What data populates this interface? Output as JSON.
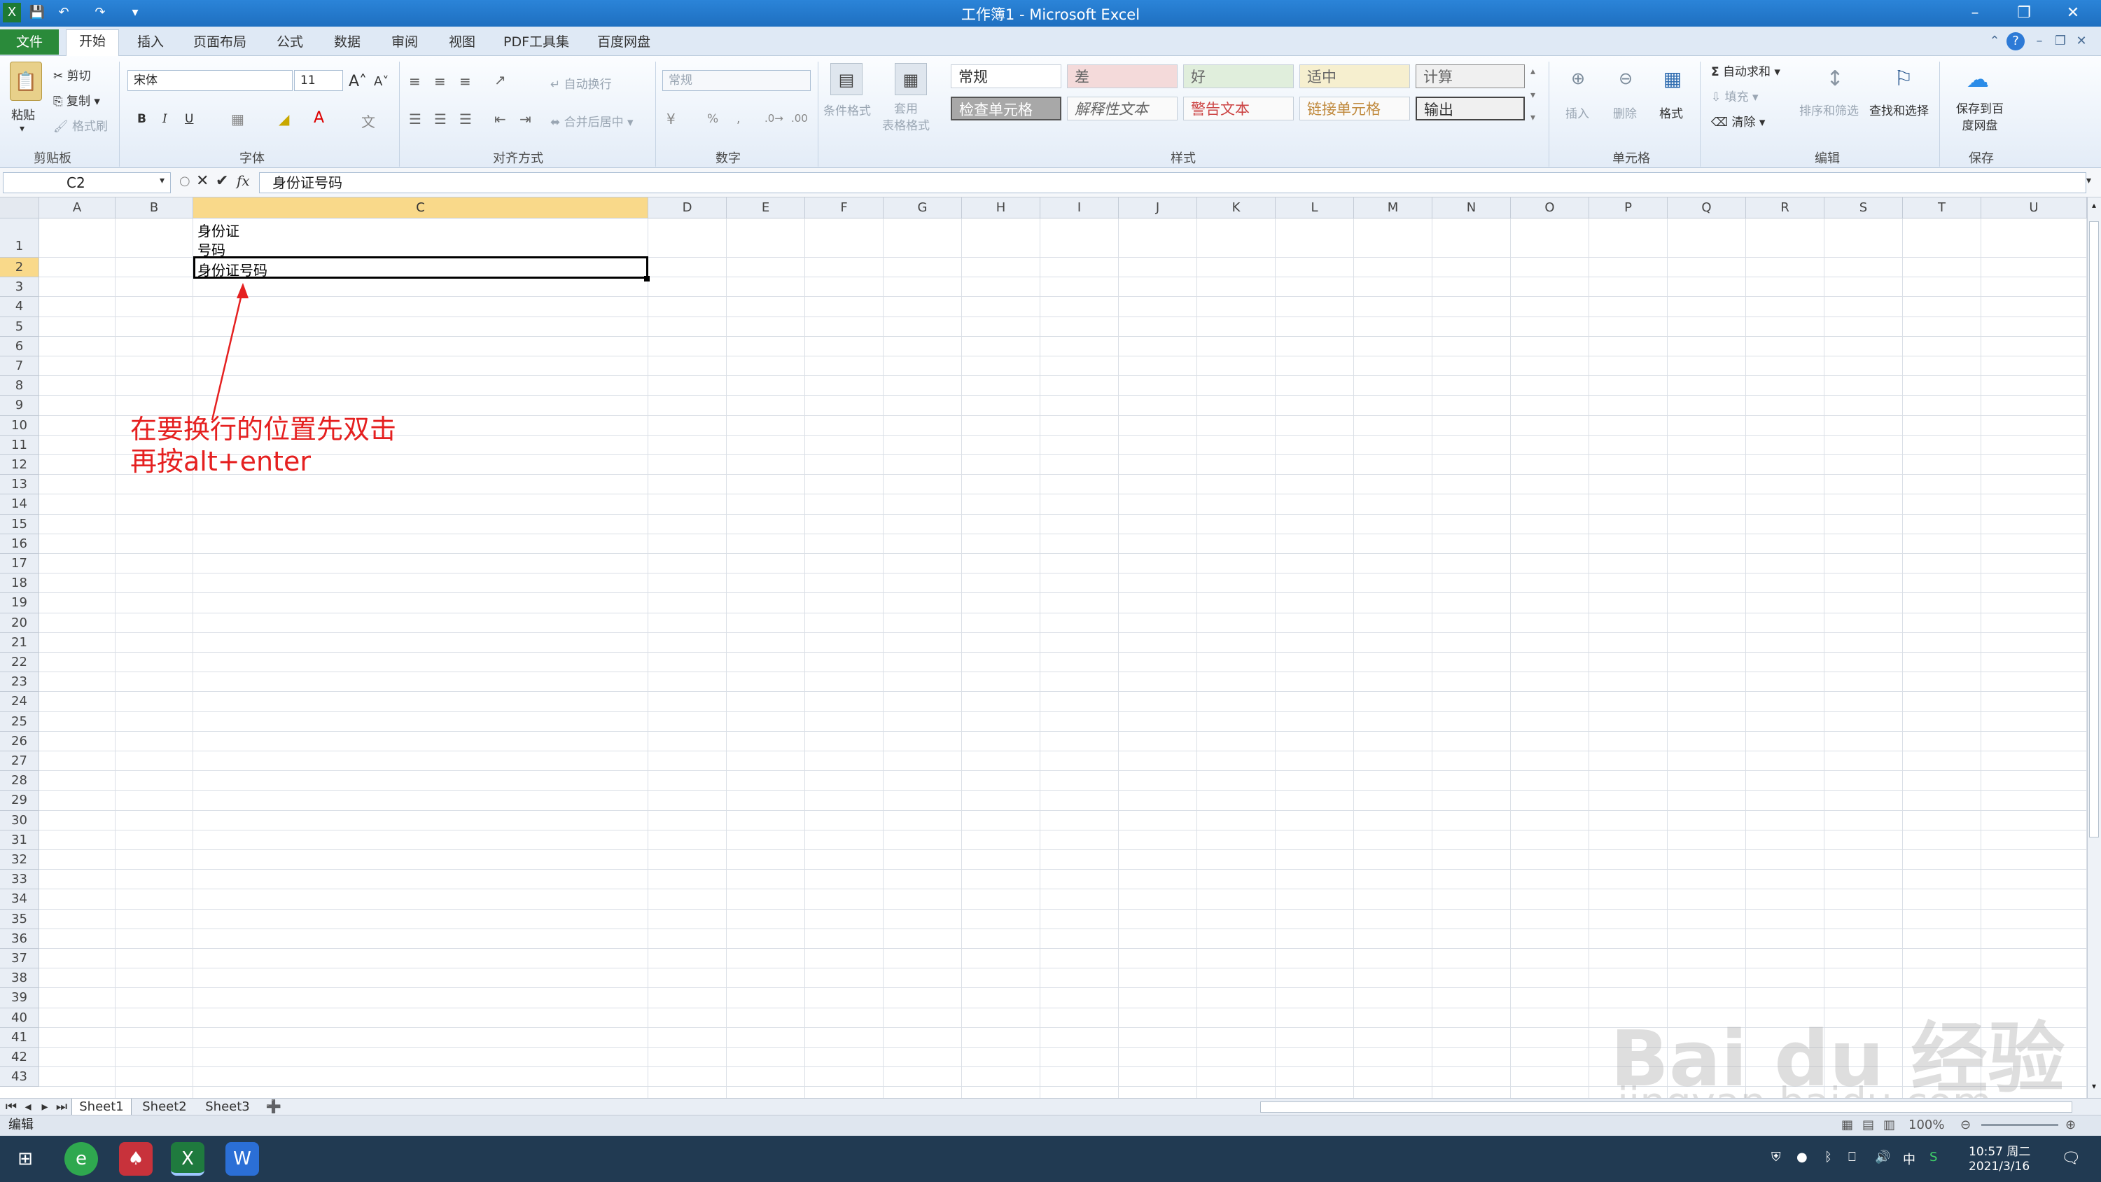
{
  "window": {
    "title": "工作簿1 - Microsoft Excel",
    "min_icon": "minimize-icon",
    "restore_icon": "restore-icon",
    "close_icon": "close-icon"
  },
  "tabs": [
    "文件",
    "开始",
    "插入",
    "页面布局",
    "公式",
    "数据",
    "审阅",
    "视图",
    "PDF工具集",
    "百度网盘"
  ],
  "ribbon": {
    "clipboard": {
      "paste": "粘贴",
      "cut": "剪切",
      "copy": "复制",
      "format_painter": "格式刷",
      "label": "剪贴板"
    },
    "font": {
      "name": "宋体",
      "size": "11",
      "bold": "B",
      "italic": "I",
      "underline": "U",
      "label": "字体"
    },
    "alignment": {
      "wrap": "自动换行",
      "merge": "合并后居中",
      "label": "对齐方式"
    },
    "number": {
      "format": "常规",
      "percent": "%",
      "comma": ",",
      "label": "数字"
    },
    "styles": {
      "conditional": "条件格式",
      "table": "套用\n表格格式",
      "cells": [
        "常规",
        "差",
        "好",
        "适中",
        "计算",
        "检查单元格",
        "解释性文本",
        "警告文本",
        "链接单元格",
        "输出"
      ],
      "label": "样式"
    },
    "cells": {
      "insert": "插入",
      "delete": "删除",
      "format": "格式",
      "label": "单元格"
    },
    "editing": {
      "autosum": "自动求和",
      "fill": "填充",
      "clear": "清除",
      "sort": "排序和筛选",
      "find": "查找和选择",
      "label": "编辑"
    },
    "save": {
      "button": "保存到百度网盘",
      "label": "保存"
    }
  },
  "formula_bar": {
    "name_box": "C2",
    "content": "身份证号码"
  },
  "columns": [
    "A",
    "B",
    "C",
    "D",
    "E",
    "F",
    "G",
    "H",
    "I",
    "J",
    "K",
    "L",
    "M",
    "N",
    "O",
    "P",
    "Q",
    "R",
    "S",
    "T",
    "U"
  ],
  "rows": [
    "1",
    "2",
    "3",
    "4",
    "5",
    "6",
    "7",
    "8",
    "9",
    "10",
    "11",
    "12",
    "13",
    "14",
    "15",
    "16",
    "17",
    "18",
    "19",
    "20",
    "21",
    "22",
    "23",
    "24",
    "25",
    "26",
    "27",
    "28",
    "29",
    "30",
    "31",
    "32",
    "33",
    "34",
    "35",
    "36",
    "37",
    "38",
    "39",
    "40",
    "41",
    "42",
    "43"
  ],
  "cells": {
    "C1_line1": "身份证",
    "C1_line2": "号码",
    "C2": "身份证号码"
  },
  "annotation": {
    "line1": "在要换行的位置先双击",
    "line2": "再按alt+enter",
    "color": "#e52020"
  },
  "sheets": [
    "Sheet1",
    "Sheet2",
    "Sheet3"
  ],
  "status": {
    "mode": "编辑",
    "zoom": "100%"
  },
  "taskbar": {
    "time": "10:57 周二",
    "date": "2021/3/16",
    "ime": "中"
  },
  "watermark": {
    "logo": "Bai du 经验",
    "url": "jingyan.baidu.com"
  }
}
